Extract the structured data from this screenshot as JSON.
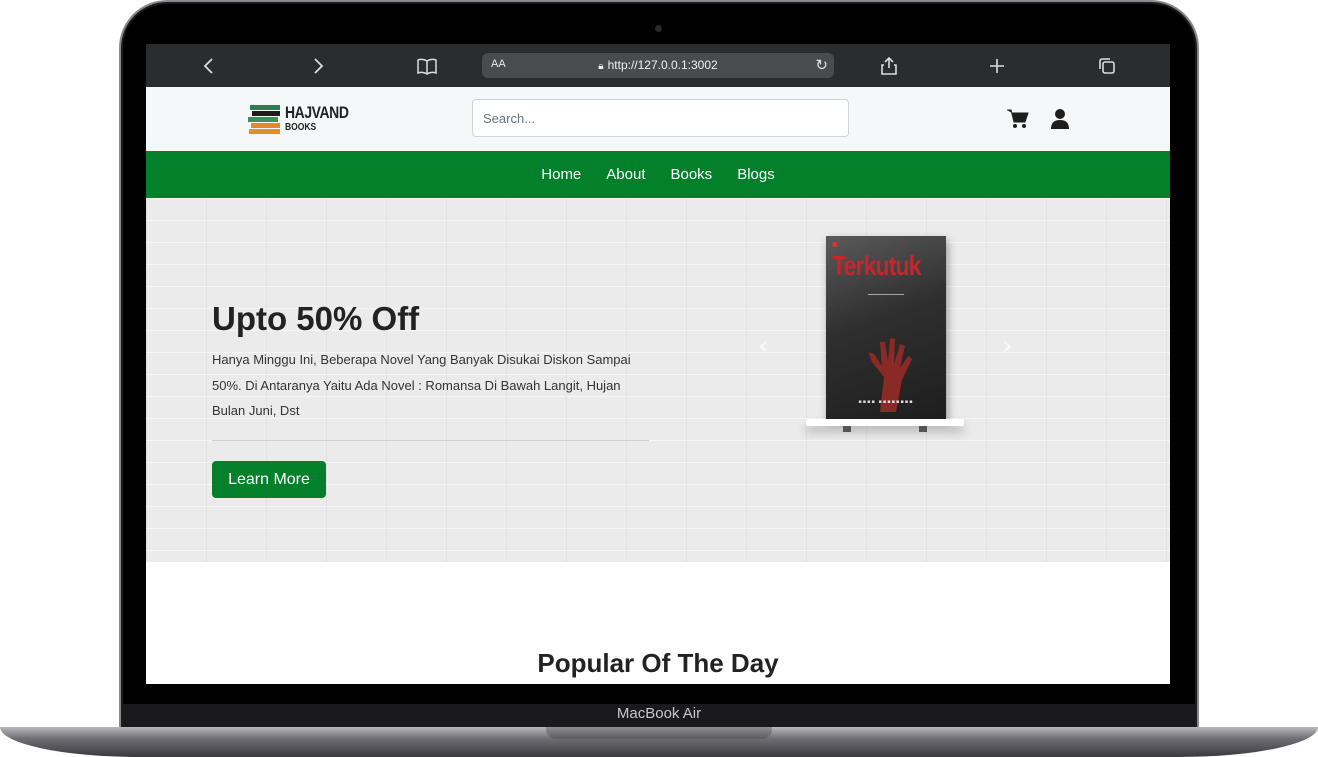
{
  "device": {
    "label": "MacBook Air"
  },
  "browser": {
    "text_size_label": "AA",
    "url": "http://127.0.0.1:3002",
    "icons": [
      "back-icon",
      "forward-icon",
      "bookmarks-icon",
      "lock-icon",
      "reload-icon",
      "share-icon",
      "new-tab-icon",
      "tabs-icon"
    ]
  },
  "header": {
    "logo_line1": "HAJVAND",
    "logo_line2": "BOOKS",
    "search_placeholder": "Search...",
    "icons": [
      "cart-icon",
      "user-icon"
    ]
  },
  "nav": {
    "items": [
      "Home",
      "About",
      "Books",
      "Blogs"
    ]
  },
  "hero": {
    "title": "Upto 50% Off",
    "description": "Hanya Minggu Ini, Beberapa Novel Yang Banyak Disukai Diskon Sampai 50%. Di Antaranya Yaitu Ada Novel : Romansa Di Bawah Langit, Hujan Bulan Juni, Dst",
    "button_label": "Learn More",
    "book": {
      "title": "Terkutuk"
    }
  },
  "section": {
    "title": "Popular Of The Day"
  },
  "colors": {
    "brand_green": "#038029",
    "browser_bar": "#2b2c2e"
  }
}
